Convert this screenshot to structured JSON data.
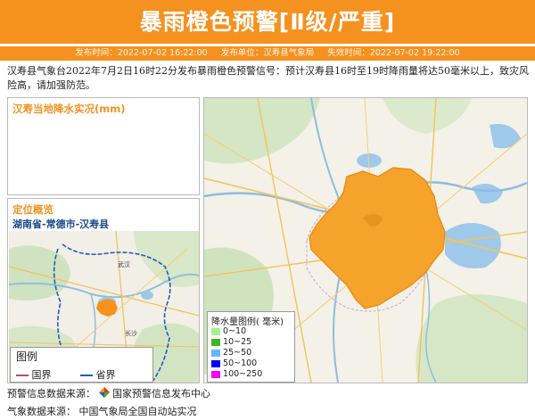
{
  "header": {
    "title": "暴雨橙色预警[Ⅱ级/严重]",
    "publish_time_label": "发布时间：",
    "publish_time": "2022-07-02 16:22:00",
    "issuer_label": "发布单位：",
    "issuer": "汉寿县气象局",
    "expire_label": "失效时间：",
    "expire_time": "2022-07-02 19:22:00"
  },
  "description": "汉寿县气象台2022年7月2日16时22分发布暴雨橙色预警信号：预计汉寿县16时至19时降雨量将达50毫米以上，致灾风险高，请加强防范。",
  "rain_panel": {
    "title": "汉寿当地降水实况(mm)"
  },
  "location_panel": {
    "title": "定位概览",
    "path": "湖南省-常德市-汉寿县",
    "city_label": "武汉",
    "city_label2": "长沙",
    "legend_title": "图例",
    "legend_items": [
      {
        "label": "国界",
        "color": "#b0506a"
      },
      {
        "label": "省界",
        "color": "#1f5cc4"
      }
    ]
  },
  "map_panel": {
    "legend_title": "降水量图例( 毫米)",
    "legend_items": [
      {
        "label": "0~10",
        "color": "#a6f28f"
      },
      {
        "label": "10~25",
        "color": "#3fb61f"
      },
      {
        "label": "25~50",
        "color": "#61b8ff"
      },
      {
        "label": "50~100",
        "color": "#0000fe"
      },
      {
        "label": "100~250",
        "color": "#fa00fa"
      }
    ],
    "warning_color": "#f5a32a"
  },
  "footer": {
    "warning_source_label": "预警信息数据来源：",
    "warning_source": "国家预警信息发布中心",
    "weather_source_label": "气象数据来源：",
    "weather_source": "中国气象局全国自动站实况"
  }
}
